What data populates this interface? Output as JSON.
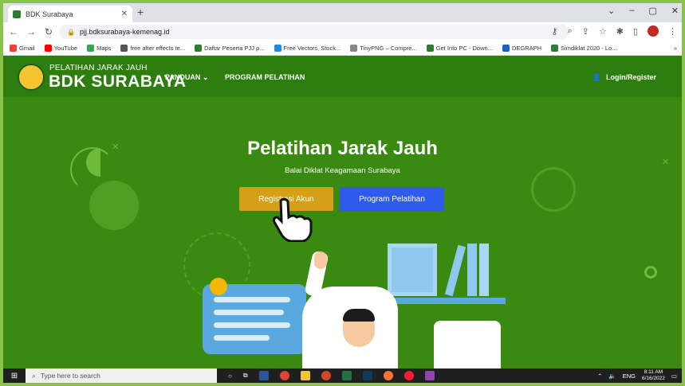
{
  "browser": {
    "tab_title": "BDK Surabaya",
    "tab_close": "✕",
    "new_tab": "+",
    "url": "pjj.bdksurabaya-kemenag.id",
    "window_controls": [
      "⌄",
      "–",
      "▢",
      "✕"
    ]
  },
  "bookmarks": [
    {
      "label": "Gmail",
      "color": "#ea4335"
    },
    {
      "label": "YouTube",
      "color": "#ff0000"
    },
    {
      "label": "Maps",
      "color": "#34a853"
    },
    {
      "label": "free after effects te...",
      "color": "#555555"
    },
    {
      "label": "Daftar Peserta PJJ p...",
      "color": "#2e7d32"
    },
    {
      "label": "Free Vectors, Stock...",
      "color": "#1e88e5"
    },
    {
      "label": "TinyPNG – Compre...",
      "color": "#888888"
    },
    {
      "label": "Get Into PC - Down...",
      "color": "#2e7d32"
    },
    {
      "label": "DEGRAPH",
      "color": "#1565c0"
    },
    {
      "label": "Simdiklat 2020 - Lo...",
      "color": "#2e7d32"
    }
  ],
  "bookmarks_more": "»",
  "site": {
    "brand_small": "PELATIHAN JARAK JAUH",
    "brand_big": "BDK SURABAYA",
    "menu": [
      {
        "label": "PANDUAN ⌄"
      },
      {
        "label": "PROGRAM PELATIHAN"
      }
    ],
    "login": "Login/Register",
    "hero_title": "Pelatihan Jarak Jauh",
    "hero_subtitle": "Balai Diklat Keagamaan Surabaya",
    "btn_register": "Registrasi Akun",
    "btn_program": "Program Pelatihan"
  },
  "taskbar": {
    "search_placeholder": "Type here to search",
    "lang": "ENG",
    "time": "8:11 AM",
    "date": "6/16/2022"
  },
  "colors": {
    "site_bg": "#3a8a12",
    "header_bg": "#2e7d0f",
    "register_btn": "#d4a017",
    "program_btn": "#2f5bea"
  }
}
